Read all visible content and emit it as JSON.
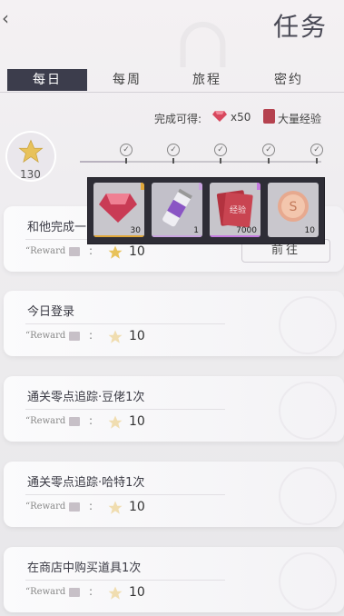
{
  "header": {
    "back_icon": "back-chevron",
    "title": "任务"
  },
  "tabs": [
    {
      "label": "每日",
      "active": true
    },
    {
      "label": "每周",
      "active": false
    },
    {
      "label": "旅程",
      "active": false
    },
    {
      "label": "密约",
      "active": false
    }
  ],
  "progress": {
    "label": "完成可得:",
    "gem_count": "x50",
    "exp_label": "大量经验",
    "score": "130",
    "checkpoints": [
      "✓",
      "✓",
      "✓",
      "✓",
      "✓"
    ]
  },
  "popup": {
    "items": [
      {
        "icon": "ruby-gem-icon",
        "count": "30",
        "bg": "#c8c6cc",
        "accent": "#e0a73a"
      },
      {
        "icon": "energy-drink-icon",
        "count": "1",
        "bg": "#c2c0c9",
        "accent": "#c9a3e0"
      },
      {
        "icon": "exp-book-icon",
        "count": "7000",
        "bg": "#c7c5cb",
        "accent": "#c57be0"
      },
      {
        "icon": "gold-coin-icon",
        "count": "10",
        "bg": "#c9c7cd",
        "accent": "#d0cfd3"
      }
    ]
  },
  "tasks": [
    {
      "name": "和他完成一",
      "reward_label": "Reward",
      "reward_value": "10",
      "go_button": "前往"
    },
    {
      "name": "今日登录",
      "reward_label": "Reward",
      "reward_value": "10"
    },
    {
      "name": "通关零点追踪·豆佬1次",
      "reward_label": "Reward",
      "reward_value": "10"
    },
    {
      "name": "通关零点追踪·哈特1次",
      "reward_label": "Reward",
      "reward_value": "10"
    },
    {
      "name": "在商店中购买道具1次",
      "reward_label": "Reward",
      "reward_value": "10"
    }
  ],
  "colors": {
    "tab_active_bg": "#3c3d4c",
    "popup_bg": "#2e2d36",
    "star": "#e8c25a"
  }
}
